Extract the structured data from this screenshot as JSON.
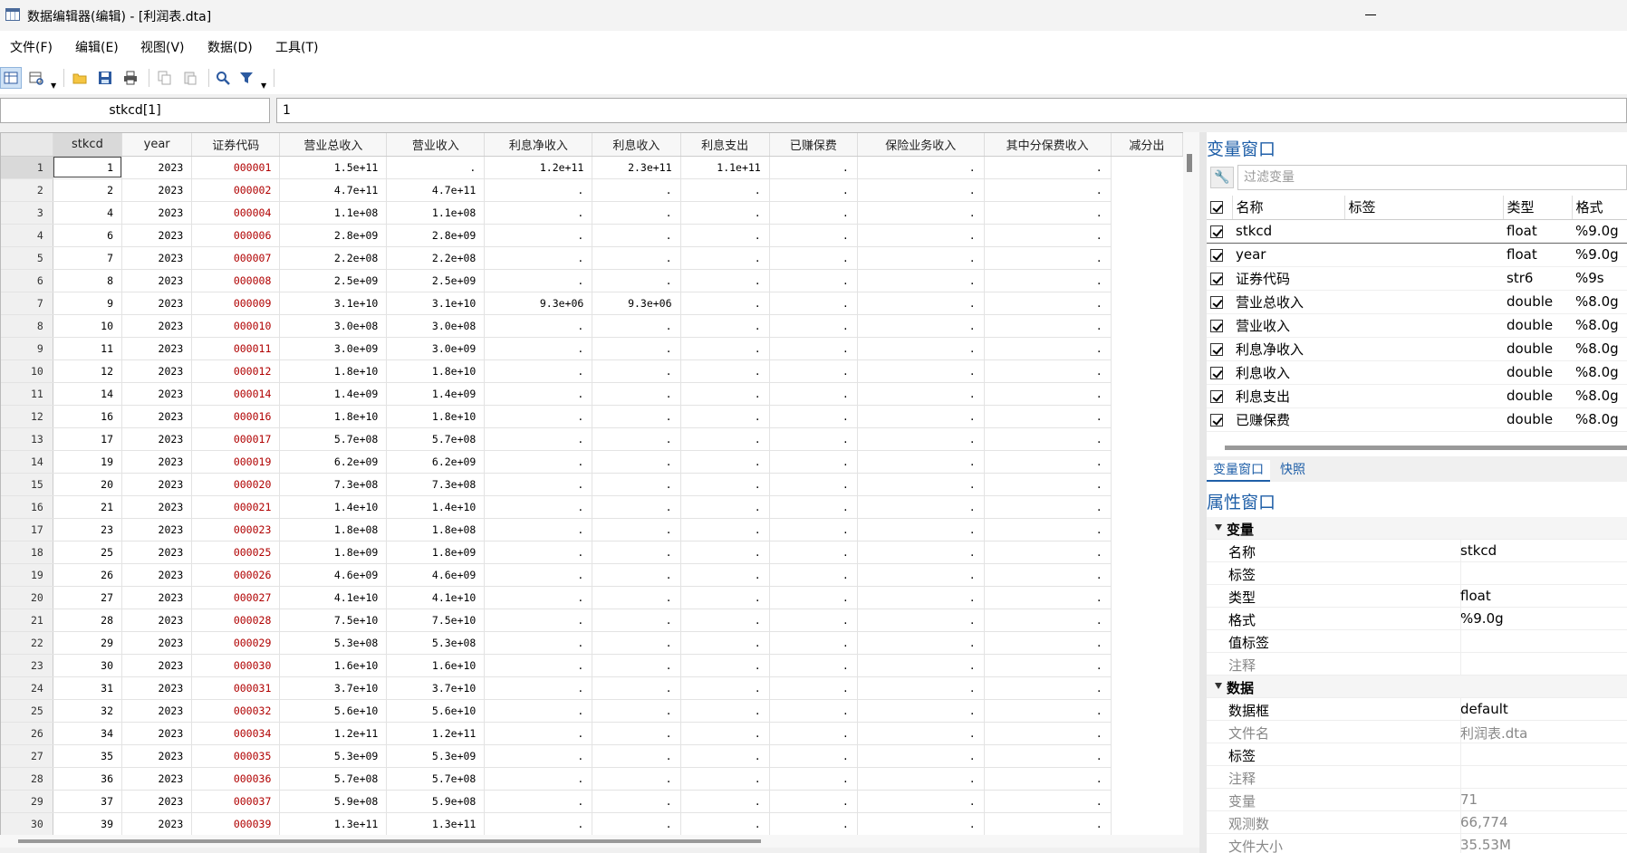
{
  "window": {
    "title": "数据编辑器(编辑) - [利润表.dta]"
  },
  "menu": [
    "文件(F)",
    "编辑(E)",
    "视图(V)",
    "数据(D)",
    "工具(T)"
  ],
  "toolbar": {
    "icons": [
      "edit-mode-icon",
      "browse-mode-icon",
      "open-folder-icon",
      "save-icon",
      "print-icon",
      "copy-icon",
      "paste-icon",
      "search-icon",
      "filter-icon"
    ]
  },
  "cellbar": {
    "name": "stkcd[1]",
    "value": "1"
  },
  "grid": {
    "columns": [
      "stkcd",
      "year",
      "证券代码",
      "营业总收入",
      "营业收入",
      "利息净收入",
      "利息收入",
      "利息支出",
      "已赚保费",
      "保险业务收入",
      "其中分保费收入",
      "减分出"
    ],
    "rows": [
      [
        "1",
        "1",
        "2023",
        "000001",
        "1.5e+11",
        ".",
        "1.2e+11",
        "2.3e+11",
        "1.1e+11",
        ".",
        ".",
        "."
      ],
      [
        "2",
        "2",
        "2023",
        "000002",
        "4.7e+11",
        "4.7e+11",
        ".",
        ".",
        ".",
        ".",
        ".",
        "."
      ],
      [
        "3",
        "4",
        "2023",
        "000004",
        "1.1e+08",
        "1.1e+08",
        ".",
        ".",
        ".",
        ".",
        ".",
        "."
      ],
      [
        "4",
        "6",
        "2023",
        "000006",
        "2.8e+09",
        "2.8e+09",
        ".",
        ".",
        ".",
        ".",
        ".",
        "."
      ],
      [
        "5",
        "7",
        "2023",
        "000007",
        "2.2e+08",
        "2.2e+08",
        ".",
        ".",
        ".",
        ".",
        ".",
        "."
      ],
      [
        "6",
        "8",
        "2023",
        "000008",
        "2.5e+09",
        "2.5e+09",
        ".",
        ".",
        ".",
        ".",
        ".",
        "."
      ],
      [
        "7",
        "9",
        "2023",
        "000009",
        "3.1e+10",
        "3.1e+10",
        "9.3e+06",
        "9.3e+06",
        ".",
        ".",
        ".",
        "."
      ],
      [
        "8",
        "10",
        "2023",
        "000010",
        "3.0e+08",
        "3.0e+08",
        ".",
        ".",
        ".",
        ".",
        ".",
        "."
      ],
      [
        "9",
        "11",
        "2023",
        "000011",
        "3.0e+09",
        "3.0e+09",
        ".",
        ".",
        ".",
        ".",
        ".",
        "."
      ],
      [
        "10",
        "12",
        "2023",
        "000012",
        "1.8e+10",
        "1.8e+10",
        ".",
        ".",
        ".",
        ".",
        ".",
        "."
      ],
      [
        "11",
        "14",
        "2023",
        "000014",
        "1.4e+09",
        "1.4e+09",
        ".",
        ".",
        ".",
        ".",
        ".",
        "."
      ],
      [
        "12",
        "16",
        "2023",
        "000016",
        "1.8e+10",
        "1.8e+10",
        ".",
        ".",
        ".",
        ".",
        ".",
        "."
      ],
      [
        "13",
        "17",
        "2023",
        "000017",
        "5.7e+08",
        "5.7e+08",
        ".",
        ".",
        ".",
        ".",
        ".",
        "."
      ],
      [
        "14",
        "19",
        "2023",
        "000019",
        "6.2e+09",
        "6.2e+09",
        ".",
        ".",
        ".",
        ".",
        ".",
        "."
      ],
      [
        "15",
        "20",
        "2023",
        "000020",
        "7.3e+08",
        "7.3e+08",
        ".",
        ".",
        ".",
        ".",
        ".",
        "."
      ],
      [
        "16",
        "21",
        "2023",
        "000021",
        "1.4e+10",
        "1.4e+10",
        ".",
        ".",
        ".",
        ".",
        ".",
        "."
      ],
      [
        "17",
        "23",
        "2023",
        "000023",
        "1.8e+08",
        "1.8e+08",
        ".",
        ".",
        ".",
        ".",
        ".",
        "."
      ],
      [
        "18",
        "25",
        "2023",
        "000025",
        "1.8e+09",
        "1.8e+09",
        ".",
        ".",
        ".",
        ".",
        ".",
        "."
      ],
      [
        "19",
        "26",
        "2023",
        "000026",
        "4.6e+09",
        "4.6e+09",
        ".",
        ".",
        ".",
        ".",
        ".",
        "."
      ],
      [
        "20",
        "27",
        "2023",
        "000027",
        "4.1e+10",
        "4.1e+10",
        ".",
        ".",
        ".",
        ".",
        ".",
        "."
      ],
      [
        "21",
        "28",
        "2023",
        "000028",
        "7.5e+10",
        "7.5e+10",
        ".",
        ".",
        ".",
        ".",
        ".",
        "."
      ],
      [
        "22",
        "29",
        "2023",
        "000029",
        "5.3e+08",
        "5.3e+08",
        ".",
        ".",
        ".",
        ".",
        ".",
        "."
      ],
      [
        "23",
        "30",
        "2023",
        "000030",
        "1.6e+10",
        "1.6e+10",
        ".",
        ".",
        ".",
        ".",
        ".",
        "."
      ],
      [
        "24",
        "31",
        "2023",
        "000031",
        "3.7e+10",
        "3.7e+10",
        ".",
        ".",
        ".",
        ".",
        ".",
        "."
      ],
      [
        "25",
        "32",
        "2023",
        "000032",
        "5.6e+10",
        "5.6e+10",
        ".",
        ".",
        ".",
        ".",
        ".",
        "."
      ],
      [
        "26",
        "34",
        "2023",
        "000034",
        "1.2e+11",
        "1.2e+11",
        ".",
        ".",
        ".",
        ".",
        ".",
        "."
      ],
      [
        "27",
        "35",
        "2023",
        "000035",
        "5.3e+09",
        "5.3e+09",
        ".",
        ".",
        ".",
        ".",
        ".",
        "."
      ],
      [
        "28",
        "36",
        "2023",
        "000036",
        "5.7e+08",
        "5.7e+08",
        ".",
        ".",
        ".",
        ".",
        ".",
        "."
      ],
      [
        "29",
        "37",
        "2023",
        "000037",
        "5.9e+08",
        "5.9e+08",
        ".",
        ".",
        ".",
        ".",
        ".",
        "."
      ],
      [
        "30",
        "39",
        "2023",
        "000039",
        "1.3e+11",
        "1.3e+11",
        ".",
        ".",
        ".",
        ".",
        ".",
        "."
      ]
    ]
  },
  "variables_window": {
    "title": "变量窗口",
    "filter_placeholder": "过滤变量",
    "headers": [
      "名称",
      "标签",
      "类型",
      "格式"
    ],
    "rows": [
      [
        "stkcd",
        "",
        "float",
        "%9.0g"
      ],
      [
        "year",
        "",
        "float",
        "%9.0g"
      ],
      [
        "证券代码",
        "",
        "str6",
        "%9s"
      ],
      [
        "营业总收入",
        "",
        "double",
        "%8.0g"
      ],
      [
        "营业收入",
        "",
        "double",
        "%8.0g"
      ],
      [
        "利息净收入",
        "",
        "double",
        "%8.0g"
      ],
      [
        "利息收入",
        "",
        "double",
        "%8.0g"
      ],
      [
        "利息支出",
        "",
        "double",
        "%8.0g"
      ],
      [
        "已赚保费",
        "",
        "double",
        "%8.0g"
      ]
    ]
  },
  "tabs": [
    "变量窗口",
    "快照"
  ],
  "properties_window": {
    "title": "属性窗口",
    "sections": [
      {
        "name": "变量",
        "rows": [
          {
            "key": "名称",
            "value": "stkcd",
            "dim": false
          },
          {
            "key": "标签",
            "value": "",
            "dim": false
          },
          {
            "key": "类型",
            "value": "float",
            "dim": false
          },
          {
            "key": "格式",
            "value": "%9.0g",
            "dim": false
          },
          {
            "key": "值标签",
            "value": "",
            "dim": false
          },
          {
            "key": "注释",
            "value": "",
            "dim": true
          }
        ]
      },
      {
        "name": "数据",
        "rows": [
          {
            "key": "数据框",
            "value": "default",
            "dim": false
          },
          {
            "key": "文件名",
            "value": "利润表.dta",
            "dim": true
          },
          {
            "key": "标签",
            "value": "",
            "dim": false
          },
          {
            "key": "注释",
            "value": "",
            "dim": true
          },
          {
            "key": "变量",
            "value": "71",
            "dim": true
          },
          {
            "key": "观测数",
            "value": "66,774",
            "dim": true
          },
          {
            "key": "文件大小",
            "value": "35.53M",
            "dim": true
          }
        ]
      }
    ]
  },
  "colors": {
    "accent": "#1f5fa8",
    "string_value": "#b00000"
  }
}
